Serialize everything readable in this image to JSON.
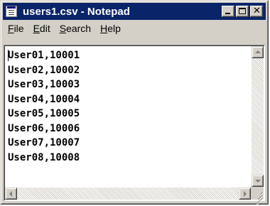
{
  "window": {
    "title": "users1.csv - Notepad",
    "accent_color": "#0a246a",
    "app_icon": "notepad-icon",
    "caption_buttons": [
      "minimize-icon",
      "maximize-icon",
      "close-icon"
    ]
  },
  "menu": {
    "items": [
      {
        "label_acc": "F",
        "label_rest": "ile"
      },
      {
        "label_acc": "E",
        "label_rest": "dit"
      },
      {
        "label_acc": "S",
        "label_rest": "earch"
      },
      {
        "label_acc": "H",
        "label_rest": "elp"
      }
    ]
  },
  "editor": {
    "lines": [
      "User01,10001",
      "User02,10002",
      "User03,10003",
      "User04,10004",
      "User05,10005",
      "User06,10006",
      "User07,10007",
      "User08,10008"
    ]
  },
  "scrollbars": {
    "vertical": [
      "scroll-up-arrow-icon",
      "scroll-down-arrow-icon"
    ],
    "horizontal": [
      "scroll-left-arrow-icon",
      "scroll-right-arrow-icon"
    ]
  }
}
